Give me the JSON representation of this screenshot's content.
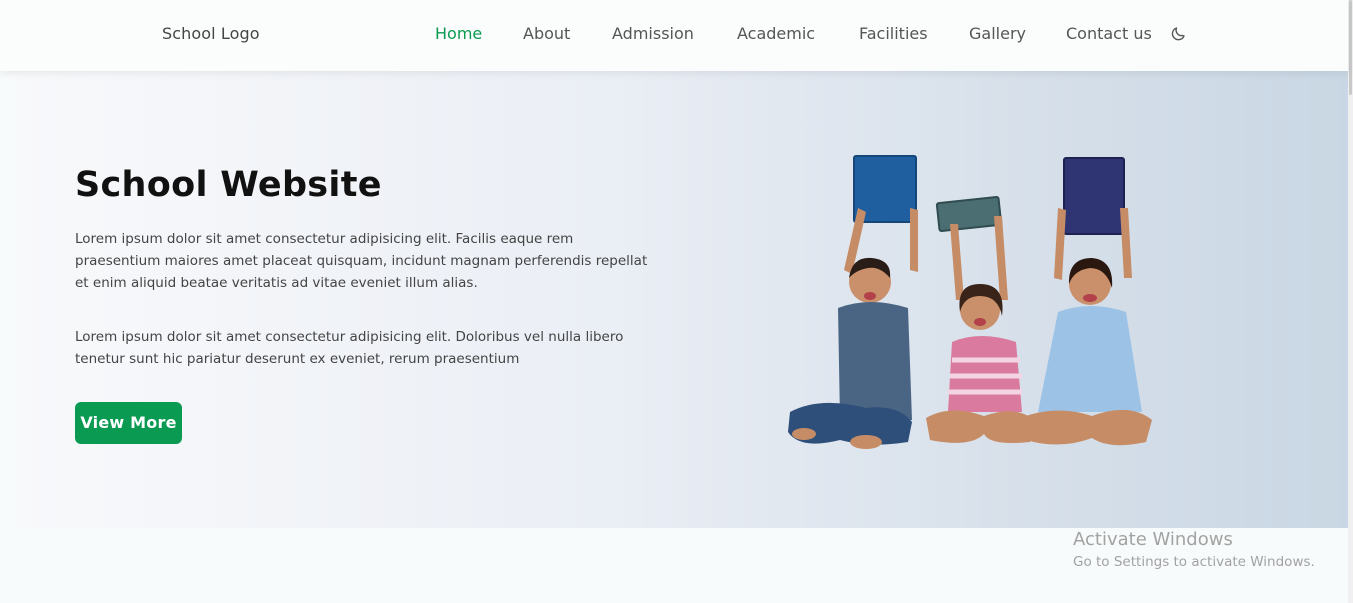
{
  "header": {
    "logo": "School Logo",
    "nav": [
      {
        "label": "Home",
        "active": true
      },
      {
        "label": "About",
        "active": false
      },
      {
        "label": "Admission",
        "active": false
      },
      {
        "label": "Academic",
        "active": false
      },
      {
        "label": "Facilities",
        "active": false
      },
      {
        "label": "Gallery",
        "active": false
      },
      {
        "label": "Contact us",
        "active": false
      }
    ],
    "theme_icon": "moon-icon"
  },
  "hero": {
    "title": "School Website",
    "paragraph1": "Lorem ipsum dolor sit amet consectetur adipisicing elit. Facilis eaque rem praesentium maiores amet placeat quisquam, incidunt magnam perferendis repellat et enim aliquid beatae veritatis ad vitae eveniet illum alias.",
    "paragraph2": "Lorem ipsum dolor sit amet consectetur adipisicing elit. Doloribus vel nulla libero tenetur sunt hic pariatur deserunt ex eveniet, rerum praesentium",
    "button_label": "View More",
    "image": "children-holding-books-image"
  },
  "watermark": {
    "title": "Activate Windows",
    "subtitle": "Go to Settings to activate Windows."
  },
  "colors": {
    "accent": "#0a9a52",
    "nav_text": "#555555",
    "title_text": "#111111"
  }
}
